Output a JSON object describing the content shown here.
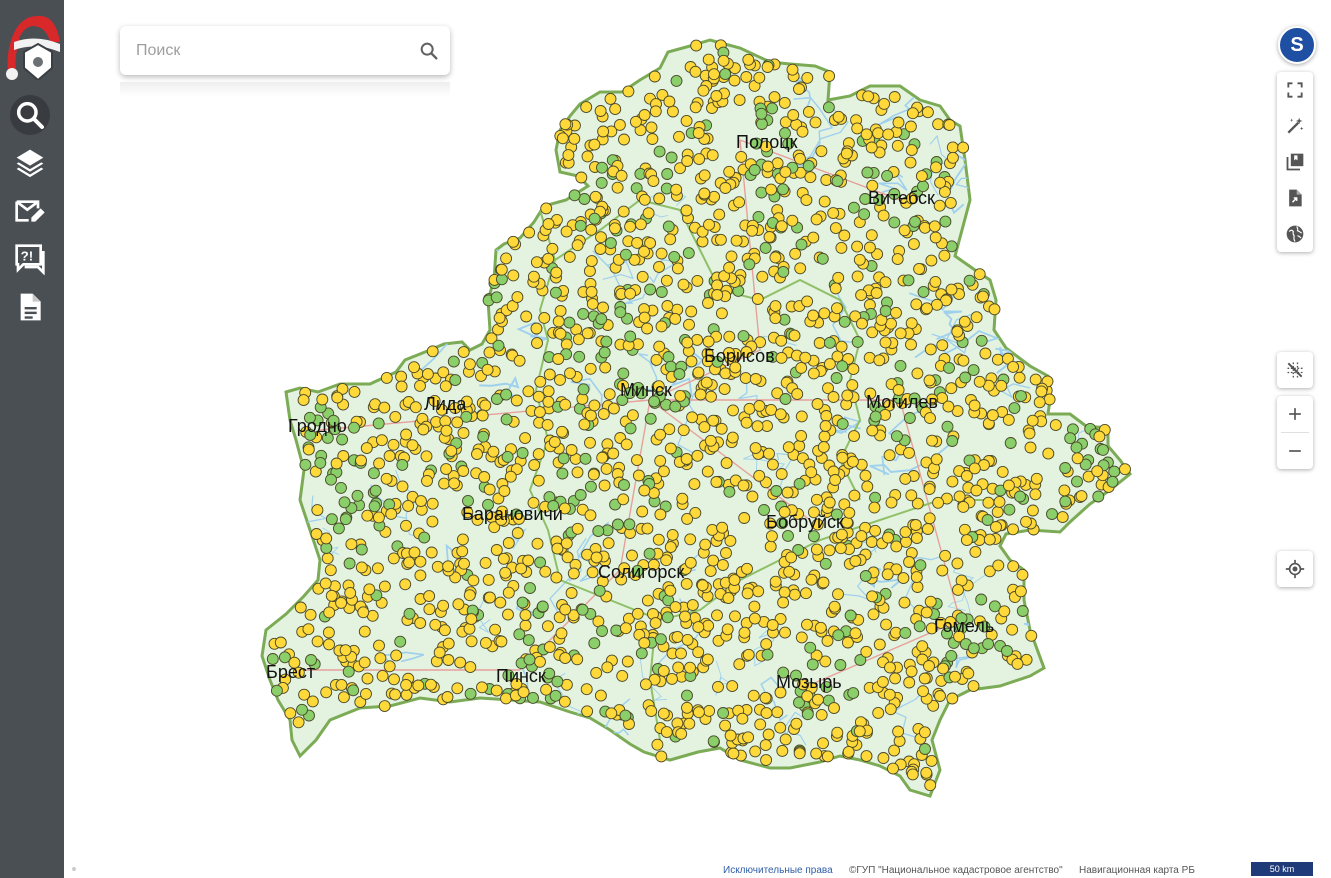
{
  "search": {
    "placeholder": "Поиск"
  },
  "sidebar": {
    "items": [
      {
        "icon": "search-icon"
      },
      {
        "icon": "layers-icon"
      },
      {
        "icon": "mail-edit-icon"
      },
      {
        "icon": "question-feedback-icon"
      },
      {
        "icon": "document-icon"
      }
    ]
  },
  "user": {
    "avatar_letter": "S"
  },
  "toolbar": {
    "top_icons": [
      "fullscreen-icon",
      "magic-wand-icon",
      "library-icon",
      "export-icon",
      "globe-icon"
    ],
    "middle_icon": "snap-off-icon",
    "zoom_icons": [
      "zoom-in-icon",
      "zoom-out-icon"
    ],
    "locate_icon": "locate-icon"
  },
  "map": {
    "cities": [
      "Полоцк",
      "Витебск",
      "Лида",
      "Гродно",
      "Борисов",
      "Минск",
      "Могилев",
      "Барановичи",
      "Бобруйск",
      "Солигорск",
      "Гомель",
      "Брест",
      "Пинск",
      "Мозырь"
    ],
    "colors": {
      "yellow_point": "#ffd83a",
      "green_point": "#8bcf6a",
      "land": "#e3f3e0",
      "border": "#7cab55",
      "water": "#9fd0ee"
    }
  },
  "footer": {
    "rights": "Исключительные права",
    "copyright": "©ГУП \"Национальное кадастровое агентство\"",
    "navmap": "Навигационная карта РБ",
    "scale": "50 km"
  }
}
